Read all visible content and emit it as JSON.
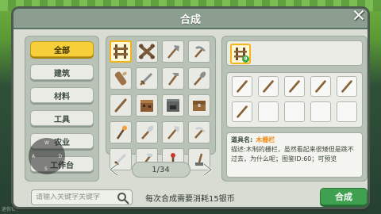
{
  "window": {
    "title": "合成"
  },
  "categories": [
    {
      "label": "全部",
      "active": true
    },
    {
      "label": "建筑",
      "active": false
    },
    {
      "label": "材料",
      "active": false
    },
    {
      "label": "工具",
      "active": false
    },
    {
      "label": "农业",
      "active": false
    },
    {
      "label": "工作台",
      "active": false
    }
  ],
  "joystick": {
    "up": "W",
    "left": "A",
    "right": "D",
    "down": "S"
  },
  "recipes": [
    {
      "icon": "wooden-fence-icon"
    },
    {
      "icon": "bone-cross-icon"
    },
    {
      "icon": "stone-axe-icon"
    },
    {
      "icon": "stone-pickaxe-icon"
    },
    {
      "icon": "wood-log-icon"
    },
    {
      "icon": "stone-sword-icon"
    },
    {
      "icon": "stone-hoe-icon"
    },
    {
      "icon": "stone-shovel-icon"
    },
    {
      "icon": "stick-icon"
    },
    {
      "icon": "crafting-table-icon"
    },
    {
      "icon": "furnace-icon"
    },
    {
      "icon": "chest-icon"
    },
    {
      "icon": "torch-icon"
    },
    {
      "icon": "iron-shovel-icon"
    },
    {
      "icon": "iron-axe-icon"
    },
    {
      "icon": "iron-pickaxe-icon"
    },
    {
      "icon": "iron-sword-icon"
    },
    {
      "icon": "iron-hoe-icon"
    },
    {
      "icon": "redstone-torch-icon"
    },
    {
      "icon": "lever-icon"
    }
  ],
  "pager": {
    "page_text": "1/34"
  },
  "result": {
    "icon": "wooden-fence-icon",
    "count": "9"
  },
  "materials": [
    "stick-icon",
    "stick-icon",
    "stick-icon",
    "stick-icon",
    "stick-icon",
    "stick-icon",
    "",
    "",
    "",
    ""
  ],
  "description": {
    "name_label": "道具名:",
    "name": "木栅栏",
    "text": "描述:木制的栅栏，虽然看起来很矮但是跳不过去，为什么呢；图鉴ID:60；可预览"
  },
  "search": {
    "placeholder": "请输入关键字关键字"
  },
  "cost_text": "每次合成需要消耗15银币",
  "craft_button": "合成",
  "version_text": "迷你世界 v0.7.2",
  "colors": {
    "accent_yellow": "#f7cf3a",
    "craft_green": "#3fa14f",
    "item_name_orange": "#f08a14"
  }
}
